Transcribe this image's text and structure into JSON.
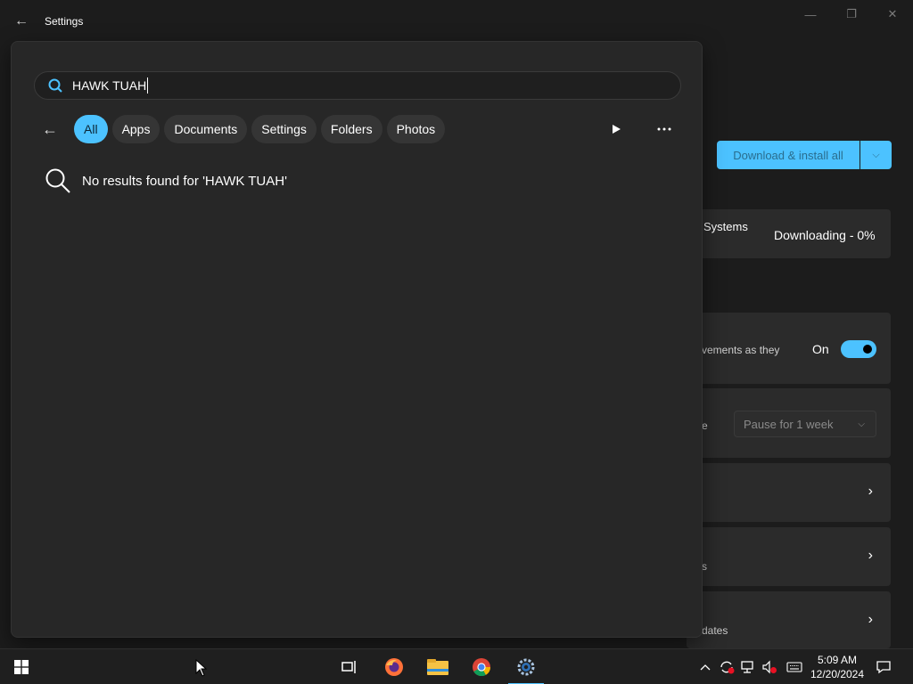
{
  "window": {
    "title": "Settings",
    "back_icon": "back-arrow-icon",
    "minimize": "—",
    "restore": "❐",
    "close": "✕"
  },
  "background": {
    "download_button": "Download & install all",
    "systems_label": "Systems",
    "downloading_status": "Downloading - 0%",
    "improvements_text": "vements as they",
    "toggle_label": "On",
    "pause_partial": "e",
    "pause_select": "Pause for 1 week",
    "row_partial_s": "s",
    "row_partial_dates": "dates",
    "accent_color": "#4cc2ff"
  },
  "search": {
    "query": "HAWK TUAH",
    "filters": [
      {
        "label": "All",
        "active": true
      },
      {
        "label": "Apps",
        "active": false
      },
      {
        "label": "Documents",
        "active": false
      },
      {
        "label": "Settings",
        "active": false
      },
      {
        "label": "Folders",
        "active": false
      },
      {
        "label": "Photos",
        "active": false
      }
    ],
    "no_results": "No results found for 'HAWK TUAH'"
  },
  "taskbar": {
    "apps": [
      "start",
      "task-view",
      "firefox",
      "file-explorer",
      "chrome",
      "settings"
    ],
    "active_app": "settings",
    "time": "5:09 AM",
    "date": "12/20/2024"
  }
}
